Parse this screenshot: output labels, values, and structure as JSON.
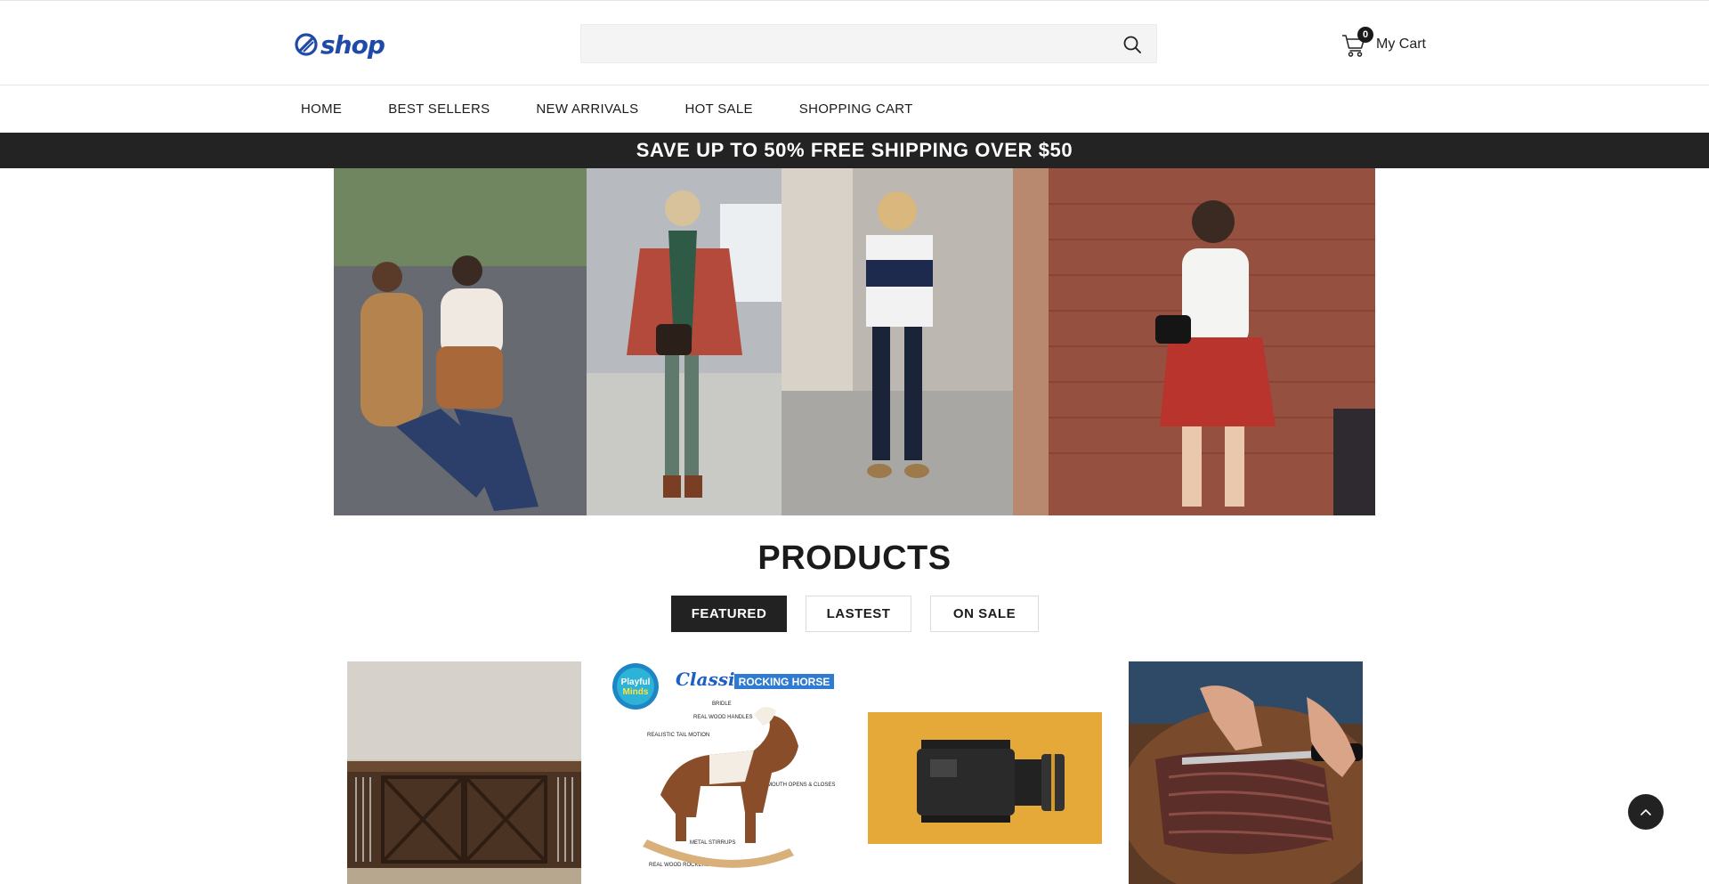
{
  "header": {
    "logo_text": "shop",
    "search": {
      "value": "",
      "placeholder": ""
    },
    "cart": {
      "count": "0",
      "label": "My Cart"
    }
  },
  "nav": {
    "items": [
      {
        "label": "HOME"
      },
      {
        "label": "BEST SELLERS"
      },
      {
        "label": "NEW ARRIVALS"
      },
      {
        "label": "HOT SALE"
      },
      {
        "label": "SHOPPING CART"
      }
    ]
  },
  "promo": {
    "text": "SAVE UP TO 50% FREE SHIPPING OVER $50"
  },
  "products": {
    "title": "PRODUCTS",
    "tabs": [
      {
        "label": "FEATURED",
        "active": true
      },
      {
        "label": "LASTEST",
        "active": false
      },
      {
        "label": "ON SALE",
        "active": false
      }
    ],
    "rocking_horse": {
      "brand_line1": "Playful",
      "brand_line2": "Minds",
      "headline_script": "Classic",
      "headline_caps": "ROCKING HORSE",
      "callouts": [
        "BRIDLE",
        "REAL WOOD HANDLES",
        "REALISTIC TAIL MOTION",
        "MOUTH OPENS & CLOSES",
        "METAL STIRRUPS",
        "REAL WOOD ROCKERS"
      ]
    }
  },
  "colors": {
    "promo_bg": "#232323",
    "logo_blue": "#1f4aa8",
    "active_tab_bg": "#222222"
  }
}
